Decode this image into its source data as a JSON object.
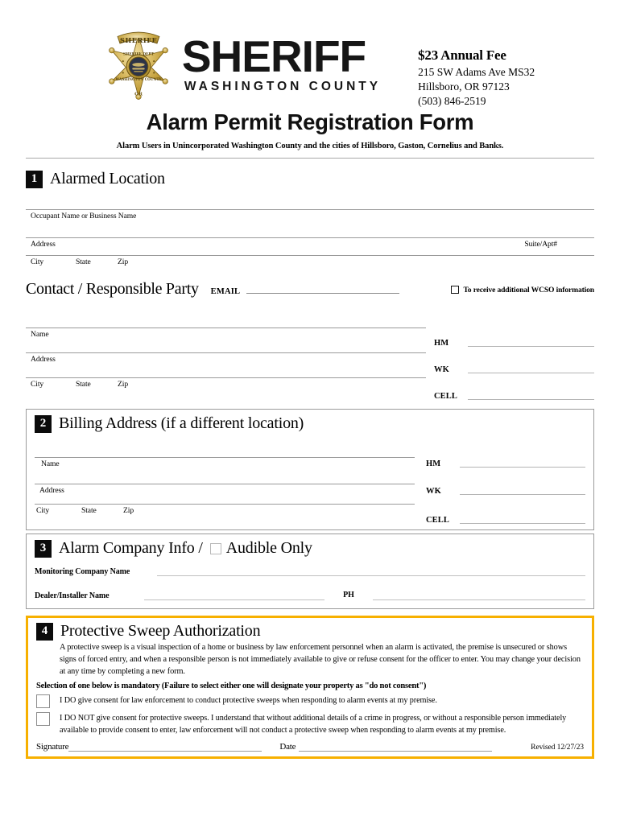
{
  "header": {
    "logo": {
      "badge_banner": "SHERIFF",
      "badge_center_top": "SHERIFF DEPT",
      "badge_center_bottom": "WASHINGTON COUNTY",
      "badge_bottom": "OR",
      "wordmark_primary": "SHERIFF",
      "wordmark_secondary": "WASHINGTON COUNTY"
    },
    "fee_title": "$23 Annual Fee",
    "address_line1": "215 SW Adams Ave MS32",
    "address_line2": "Hillsboro, OR 97123",
    "phone": "(503) 846-2519"
  },
  "title": "Alarm Permit Registration Form",
  "subtitle": "Alarm Users in Unincorporated Washington County and the cities of Hillsboro, Gaston, Cornelius and Banks.",
  "section1": {
    "number": "1",
    "title": "Alarmed Location",
    "occupant_label": "Occupant Name or Business Name",
    "address_label": "Address",
    "suite_label": "Suite/Apt#",
    "city_label": "City",
    "state_label": "State",
    "zip_label": "Zip"
  },
  "contact": {
    "title": "Contact / Responsible Party",
    "email_label": "EMAIL",
    "wcso_checkbox_label": "To receive additional WCSO information",
    "name_label": "Name",
    "address_label": "Address",
    "city_label": "City",
    "state_label": "State",
    "zip_label": "Zip",
    "phones": [
      {
        "label": "HM"
      },
      {
        "label": "WK"
      },
      {
        "label": "CELL"
      }
    ]
  },
  "section2": {
    "number": "2",
    "title": "Billing Address (if a different location)",
    "name_label": "Name",
    "address_label": "Address",
    "city_label": "City",
    "state_label": "State",
    "zip_label": "Zip",
    "phones": [
      {
        "label": "HM"
      },
      {
        "label": "WK"
      },
      {
        "label": "CELL"
      }
    ]
  },
  "section3": {
    "number": "3",
    "title_part1": "Alarm Company Info /",
    "audible_only_label": "Audible Only",
    "monitoring_label": "Monitoring Company Name",
    "dealer_label": "Dealer/Installer Name",
    "ph_label": "PH"
  },
  "section4": {
    "number": "4",
    "title": "Protective Sweep Authorization",
    "body": "A protective sweep is a visual inspection of a home or business by law enforcement personnel when an alarm is activated, the premise is unsecured or shows signs of forced entry, and when a responsible person is not immediately available to give or refuse consent for the officer to enter. You may change your decision at any time by completing a new form.",
    "mandatory_note": "Selection of one below is mandatory (Failure to select either one will designate your property as \"do not consent\")",
    "consent_yes": "I DO give consent for law enforcement to conduct protective sweeps when responding to alarm events at my premise.",
    "consent_no": "I DO NOT give consent for protective sweeps. I understand that without additional details of a crime in progress, or without a responsible person immediately available to provide consent to enter, law enforcement will not conduct a protective sweep when responding to alarm events at my premise.",
    "signature_label": "Signature",
    "date_label": "Date",
    "revised_label": "Revised 12/27/23"
  },
  "colors": {
    "accent_orange": "#f7b000",
    "badge_gold": "#c9a227",
    "rule_gray": "#9a9a9a",
    "ink": "#000000"
  }
}
